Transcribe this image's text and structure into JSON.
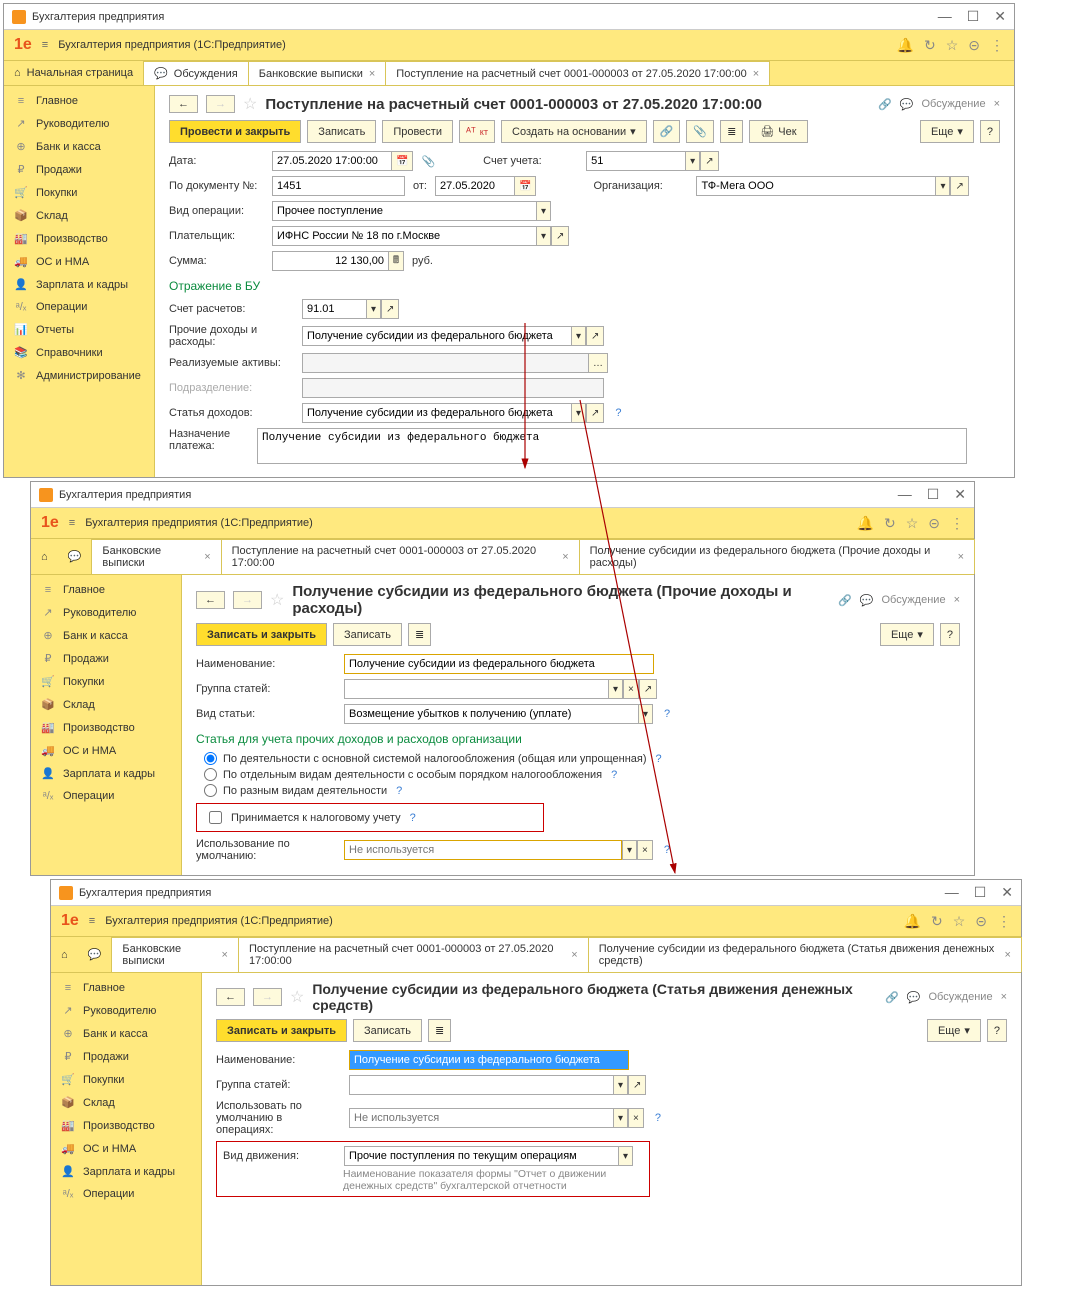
{
  "w1": {
    "title": "Бухгалтерия предприятия",
    "app": "Бухгалтерия предприятия  (1С:Предприятие)",
    "tabs": {
      "home": "Начальная страница",
      "t1": "Обсуждения",
      "t2": "Банковские выписки",
      "t3": "Поступление на расчетный счет 0001-000003 от 27.05.2020 17:00:00"
    },
    "side": [
      "Главное",
      "Руководителю",
      "Банк и касса",
      "Продажи",
      "Покупки",
      "Склад",
      "Производство",
      "ОС и НМА",
      "Зарплата и кадры",
      "Операции",
      "Отчеты",
      "Справочники",
      "Администрирование"
    ],
    "sideIcons": [
      "≡",
      "↗",
      "⊕",
      "₽",
      "🛒",
      "📦",
      "🏭",
      "🚚",
      "👤",
      "ᵃ/ₓ",
      "📊",
      "📚",
      "✻"
    ],
    "doc": {
      "title": "Поступление на расчетный счет 0001-000003 от 27.05.2020 17:00:00",
      "discuss": "Обсуждение",
      "btns": {
        "post": "Провести и закрыть",
        "save": "Записать",
        "exec": "Провести",
        "create": "Создать на основании",
        "cheque": "Чек",
        "more": "Еще"
      },
      "labels": {
        "date": "Дата:",
        "acc": "Счет учета:",
        "org": "Организация:",
        "docnum": "По документу №:",
        "from": "от:",
        "type": "Вид операции:",
        "payer": "Плательщик:",
        "sum": "Сумма:",
        "rub": "руб.",
        "sec": "Отражение в БУ",
        "accset": "Счет расчетов:",
        "other": "Прочие доходы и расходы:",
        "asset": "Реализуемые активы:",
        "dept": "Подразделение:",
        "inc": "Статья доходов:",
        "purpose": "Назначение платежа:"
      },
      "vals": {
        "date": "27.05.2020 17:00:00",
        "acc": "51",
        "org": "ТФ-Мега ООО",
        "docnum": "1451",
        "docdate": "27.05.2020",
        "type": "Прочее поступление",
        "payer": "ИФНС России № 18 по г.Москве",
        "sum": "12 130,00",
        "accset": "91.01",
        "other": "Получение субсидии из федерального бюджета",
        "inc": "Получение субсидии из федерального бюджета",
        "purpose": "Получение субсидии из федерального бюджета"
      }
    }
  },
  "w2": {
    "title": "Бухгалтерия предприятия",
    "app": "Бухгалтерия предприятия  (1С:Предприятие)",
    "tabs": {
      "t1": "Банковские выписки",
      "t2": "Поступление на расчетный счет 0001-000003 от 27.05.2020 17:00:00",
      "t3": "Получение субсидии из федерального бюджета (Прочие доходы и расходы)"
    },
    "side": [
      "Главное",
      "Руководителю",
      "Банк и касса",
      "Продажи",
      "Покупки",
      "Склад",
      "Производство",
      "ОС и НМА",
      "Зарплата и кадры",
      "Операции"
    ],
    "sideIcons": [
      "≡",
      "↗",
      "⊕",
      "₽",
      "🛒",
      "📦",
      "🏭",
      "🚚",
      "👤",
      "ᵃ/ₓ"
    ],
    "doc": {
      "title": "Получение субсидии из федерального бюджета (Прочие доходы и расходы)",
      "discuss": "Обсуждение",
      "btns": {
        "save": "Записать и закрыть",
        "write": "Записать",
        "more": "Еще"
      },
      "labels": {
        "name": "Наименование:",
        "group": "Группа статей:",
        "type": "Вид статьи:",
        "sec": "Статья для учета прочих доходов и расходов организации",
        "r1": "По деятельности с основной системой налогообложения (общая или упрощенная)",
        "r2": "По отдельным видам деятельности с особым порядком налогообложения",
        "r3": "По разным видам деятельности",
        "chk": "Принимается к налоговому учету",
        "default": "Использование по умолчанию:"
      },
      "vals": {
        "name": "Получение субсидии из федерального бюджета",
        "type": "Возмещение убытков к получению (уплате)",
        "default": "Не используется"
      }
    }
  },
  "w3": {
    "title": "Бухгалтерия предприятия",
    "app": "Бухгалтерия предприятия  (1С:Предприятие)",
    "tabs": {
      "t1": "Банковские выписки",
      "t2": "Поступление на расчетный счет 0001-000003 от 27.05.2020 17:00:00",
      "t3": "Получение субсидии из федерального бюджета (Статья движения денежных средств)"
    },
    "side": [
      "Главное",
      "Руководителю",
      "Банк и касса",
      "Продажи",
      "Покупки",
      "Склад",
      "Производство",
      "ОС и НМА",
      "Зарплата и кадры",
      "Операции"
    ],
    "sideIcons": [
      "≡",
      "↗",
      "⊕",
      "₽",
      "🛒",
      "📦",
      "🏭",
      "🚚",
      "👤",
      "ᵃ/ₓ"
    ],
    "doc": {
      "title": "Получение субсидии из федерального бюджета (Статья движения денежных средств)",
      "discuss": "Обсуждение",
      "btns": {
        "save": "Записать и закрыть",
        "write": "Записать",
        "more": "Еще"
      },
      "labels": {
        "name": "Наименование:",
        "group": "Группа статей:",
        "default": "Использовать по умолчанию в операциях:",
        "move": "Вид движения:",
        "desc": "Наименование показателя формы \"Отчет о движении денежных средств\" бухгалтерской отчетности"
      },
      "vals": {
        "name": "Получение субсидии из федерального бюджета",
        "default": "Не используется",
        "move": "Прочие поступления по текущим операциям"
      }
    }
  }
}
